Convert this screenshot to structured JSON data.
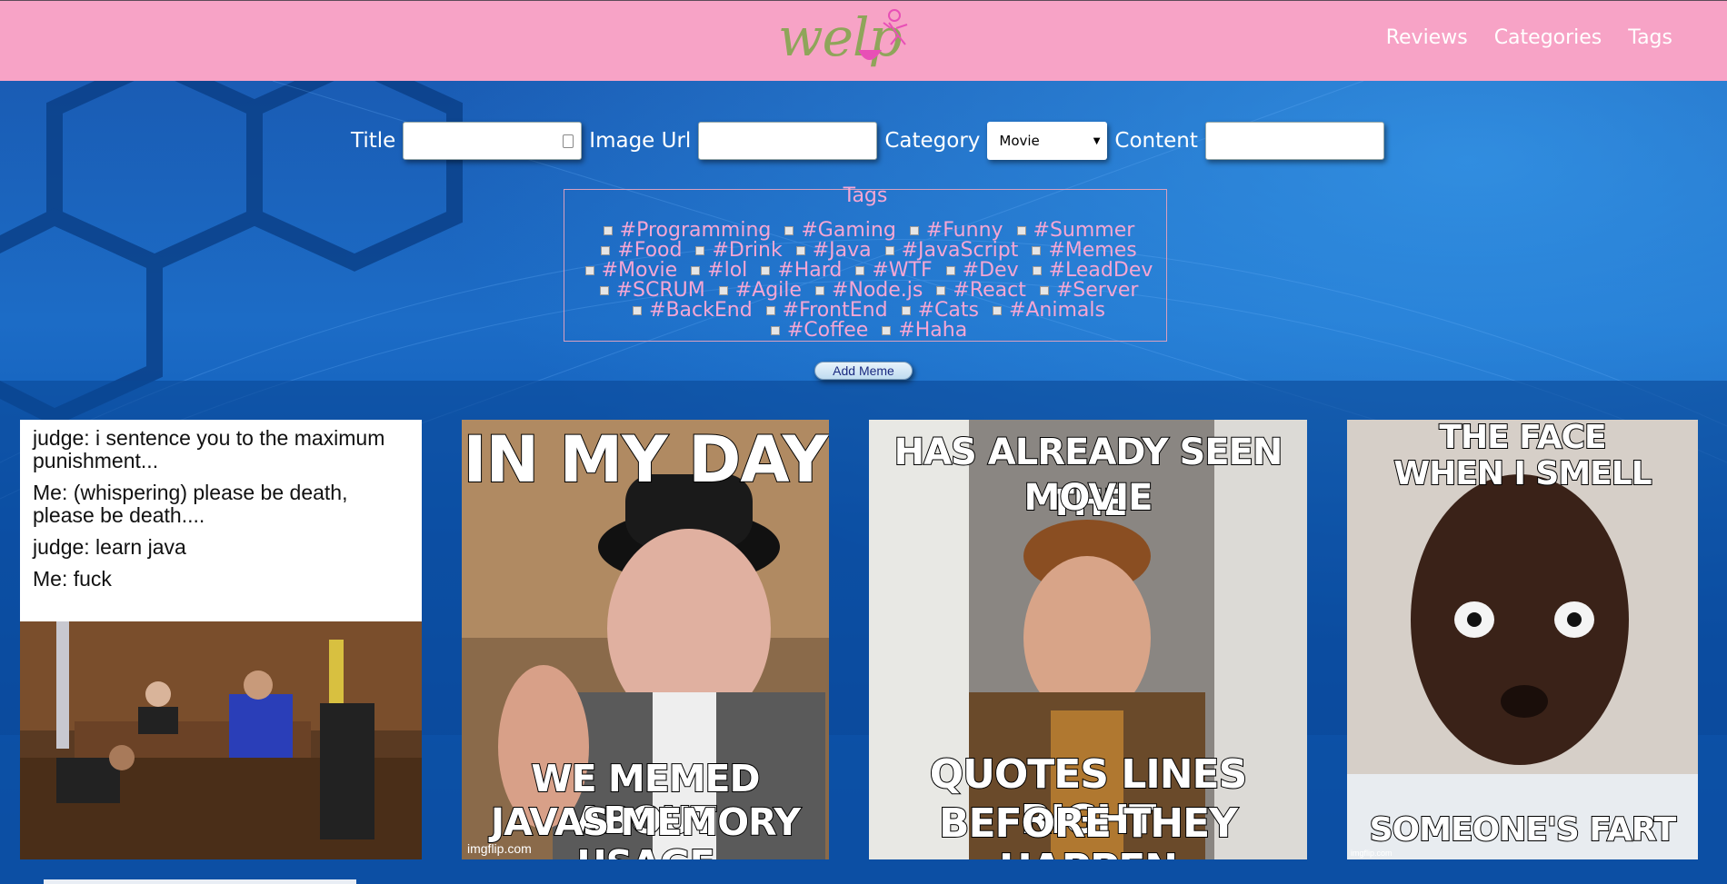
{
  "header": {
    "logo_text": "welp",
    "nav": [
      "Reviews",
      "Categories",
      "Tags"
    ]
  },
  "form": {
    "title_label": "Title",
    "image_url_label": "Image Url",
    "category_label": "Category",
    "category_selected": "Movie",
    "content_label": "Content",
    "tags_legend": "Tags",
    "tags": [
      "#Programming",
      "#Gaming",
      "#Funny",
      "#Summer",
      "#Food",
      "#Drink",
      "#Java",
      "#JavaScript",
      "#Memes",
      "#Movie",
      "#lol",
      "#Hard",
      "#WTF",
      "#Dev",
      "#LeadDev",
      "#SCRUM",
      "#Agile",
      "#Node.js",
      "#React",
      "#Server",
      "#BackEnd",
      "#FrontEnd",
      "#Cats",
      "#Animals",
      "#Coffee",
      "#Haha"
    ],
    "add_button": "Add Meme"
  },
  "memes": [
    {
      "lines": [
        "judge: i sentence you to the maximum punishment...",
        "Me: (whispering) please be death, please be death....",
        "judge: learn java",
        "Me: fuck"
      ]
    },
    {
      "top": "IN MY DAY",
      "bottom_1": "WE MEMED ABOUT",
      "bottom_2": "JAVAS MEMORY USAGE",
      "watermark": "imgflip.com"
    },
    {
      "top_1": "HAS ALREADY SEEN THE",
      "top_2": "MOVIE",
      "bottom_1": "QUOTES LINES RIGHT",
      "bottom_2": "BEFORE THEY HAPPEN"
    },
    {
      "top_1": "THE FACE",
      "top_2": "WHEN I SMELL",
      "bottom": "SOMEONE'S FART",
      "watermark": "imgflip.com"
    }
  ],
  "colors": {
    "header_bg": "#f7a3c6",
    "tag_text": "#f5a6d4",
    "logo_green": "#8fa55a"
  }
}
